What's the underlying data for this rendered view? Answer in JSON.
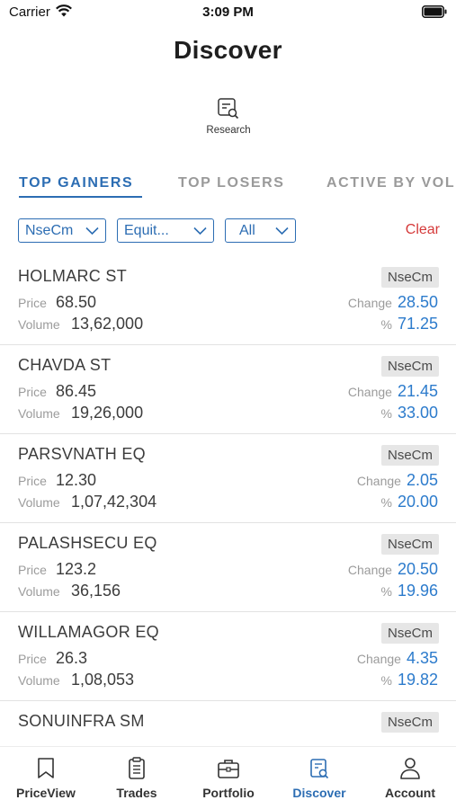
{
  "status_bar": {
    "carrier": "Carrier",
    "time": "3:09 PM"
  },
  "page": {
    "title": "Discover"
  },
  "research": {
    "label": "Research",
    "icon": "research-doc-search-icon"
  },
  "tabs": [
    {
      "label": "TOP GAINERS",
      "active": true
    },
    {
      "label": "TOP LOSERS",
      "active": false
    },
    {
      "label": "ACTIVE BY VOLUME",
      "active": false
    }
  ],
  "filters": {
    "exchange": "NseCm",
    "segment": "Equit...",
    "group": "All",
    "clear_label": "Clear"
  },
  "labels": {
    "price": "Price",
    "volume": "Volume",
    "change": "Change",
    "percent": "%"
  },
  "stocks": [
    {
      "symbol": "HOLMARC ST",
      "exchange": "NseCm",
      "price": "68.50",
      "volume": "13,62,000",
      "change": "28.50",
      "percent": "71.25"
    },
    {
      "symbol": "CHAVDA ST",
      "exchange": "NseCm",
      "price": "86.45",
      "volume": "19,26,000",
      "change": "21.45",
      "percent": "33.00"
    },
    {
      "symbol": "PARSVNATH EQ",
      "exchange": "NseCm",
      "price": "12.30",
      "volume": "1,07,42,304",
      "change": "2.05",
      "percent": "20.00"
    },
    {
      "symbol": "PALASHSECU EQ",
      "exchange": "NseCm",
      "price": "123.2",
      "volume": "36,156",
      "change": "20.50",
      "percent": "19.96"
    },
    {
      "symbol": "WILLAMAGOR EQ",
      "exchange": "NseCm",
      "price": "26.3",
      "volume": "1,08,053",
      "change": "4.35",
      "percent": "19.82"
    },
    {
      "symbol": "SONUINFRA SM",
      "exchange": "NseCm",
      "price": "",
      "volume": "",
      "change": "",
      "percent": ""
    }
  ],
  "tabbar": [
    {
      "label": "PriceView",
      "icon": "bookmark-icon",
      "active": false
    },
    {
      "label": "Trades",
      "icon": "clipboard-icon",
      "active": false
    },
    {
      "label": "Portfolio",
      "icon": "briefcase-icon",
      "active": false
    },
    {
      "label": "Discover",
      "icon": "discover-doc-search-icon",
      "active": true
    },
    {
      "label": "Account",
      "icon": "person-icon",
      "active": false
    }
  ],
  "colors": {
    "accent": "#2c6db3",
    "value_blue": "#2c7bcc",
    "clear_red": "#d53a3a"
  }
}
